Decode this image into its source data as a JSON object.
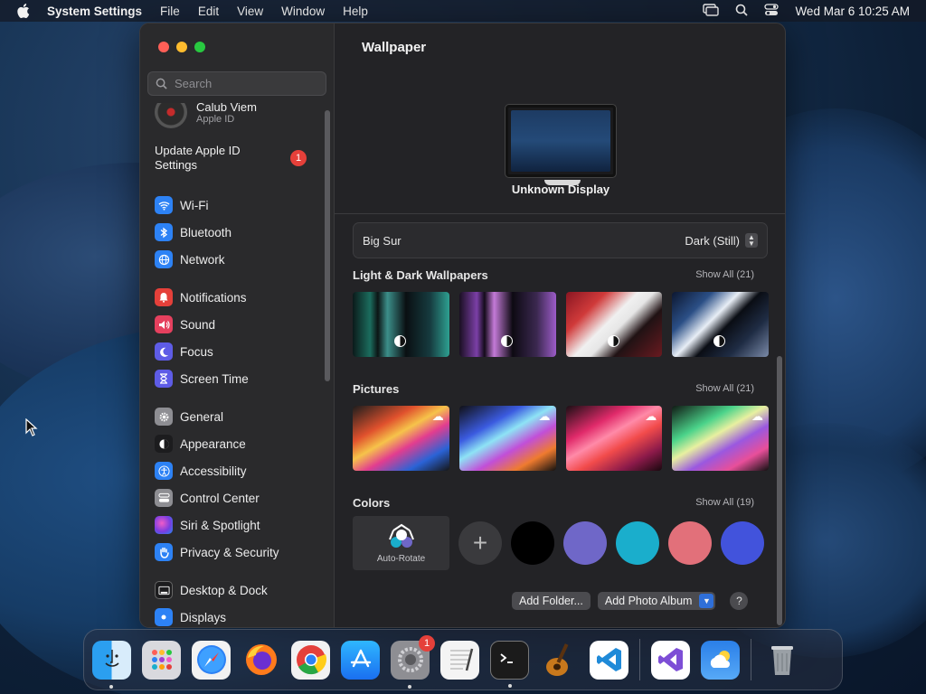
{
  "menubar": {
    "app_name": "System Settings",
    "menus": [
      "File",
      "Edit",
      "View",
      "Window",
      "Help"
    ],
    "clock": "Wed Mar 6  10:25 AM"
  },
  "sidebar": {
    "search_placeholder": "Search",
    "account": {
      "name": "Calub Viem",
      "subtitle": "Apple ID"
    },
    "update": {
      "label": "Update Apple ID Settings",
      "badge": "1"
    },
    "groups": [
      [
        {
          "label": "Wi-Fi",
          "icon": "wifi-icon",
          "color": "#2d82f5"
        },
        {
          "label": "Bluetooth",
          "icon": "bluetooth-icon",
          "color": "#2d82f5"
        },
        {
          "label": "Network",
          "icon": "globe-icon",
          "color": "#2d82f5"
        }
      ],
      [
        {
          "label": "Notifications",
          "icon": "bell-icon",
          "color": "#e5403a"
        },
        {
          "label": "Sound",
          "icon": "speaker-icon",
          "color": "#e5405e"
        },
        {
          "label": "Focus",
          "icon": "moon-icon",
          "color": "#5e5ce6"
        },
        {
          "label": "Screen Time",
          "icon": "hourglass-icon",
          "color": "#5e5ce6"
        }
      ],
      [
        {
          "label": "General",
          "icon": "gear-icon",
          "color": "#8e8e93"
        },
        {
          "label": "Appearance",
          "icon": "appearance-icon",
          "color": "#1c1c1e"
        },
        {
          "label": "Accessibility",
          "icon": "accessibility-icon",
          "color": "#2d82f5"
        },
        {
          "label": "Control Center",
          "icon": "control-center-icon",
          "color": "#8e8e93"
        },
        {
          "label": "Siri & Spotlight",
          "icon": "siri-icon",
          "color": "#a23fd1"
        },
        {
          "label": "Privacy & Security",
          "icon": "hand-icon",
          "color": "#2d82f5"
        }
      ],
      [
        {
          "label": "Desktop & Dock",
          "icon": "dock-icon",
          "color": "#1c1c1e"
        },
        {
          "label": "Displays",
          "icon": "displays-icon",
          "color": "#2d82f5"
        }
      ]
    ]
  },
  "main": {
    "title": "Wallpaper",
    "display_name": "Unknown Display",
    "selector": {
      "name": "Big Sur",
      "value": "Dark (Still)"
    },
    "sections": {
      "light_dark": {
        "title": "Light & Dark Wallpapers",
        "show_all": "Show All (21)"
      },
      "pictures": {
        "title": "Pictures",
        "show_all": "Show All (21)"
      },
      "colors": {
        "title": "Colors",
        "show_all": "Show All (19)"
      }
    },
    "auto_rotate_label": "Auto-Rotate",
    "color_swatches": [
      "#000000",
      "#6f67c8",
      "#1aaecc",
      "#e2707a",
      "#4253dc"
    ],
    "buttons": {
      "add_folder": "Add Folder...",
      "add_photo_album": "Add Photo Album",
      "help": "?"
    }
  },
  "dock": {
    "settings_badge": "1",
    "apps": [
      "finder",
      "launchpad",
      "safari",
      "firefox",
      "chrome",
      "app-store",
      "system-settings",
      "textedit",
      "terminal",
      "garageband",
      "vscode",
      "visual-studio",
      "weather",
      "trash"
    ]
  }
}
